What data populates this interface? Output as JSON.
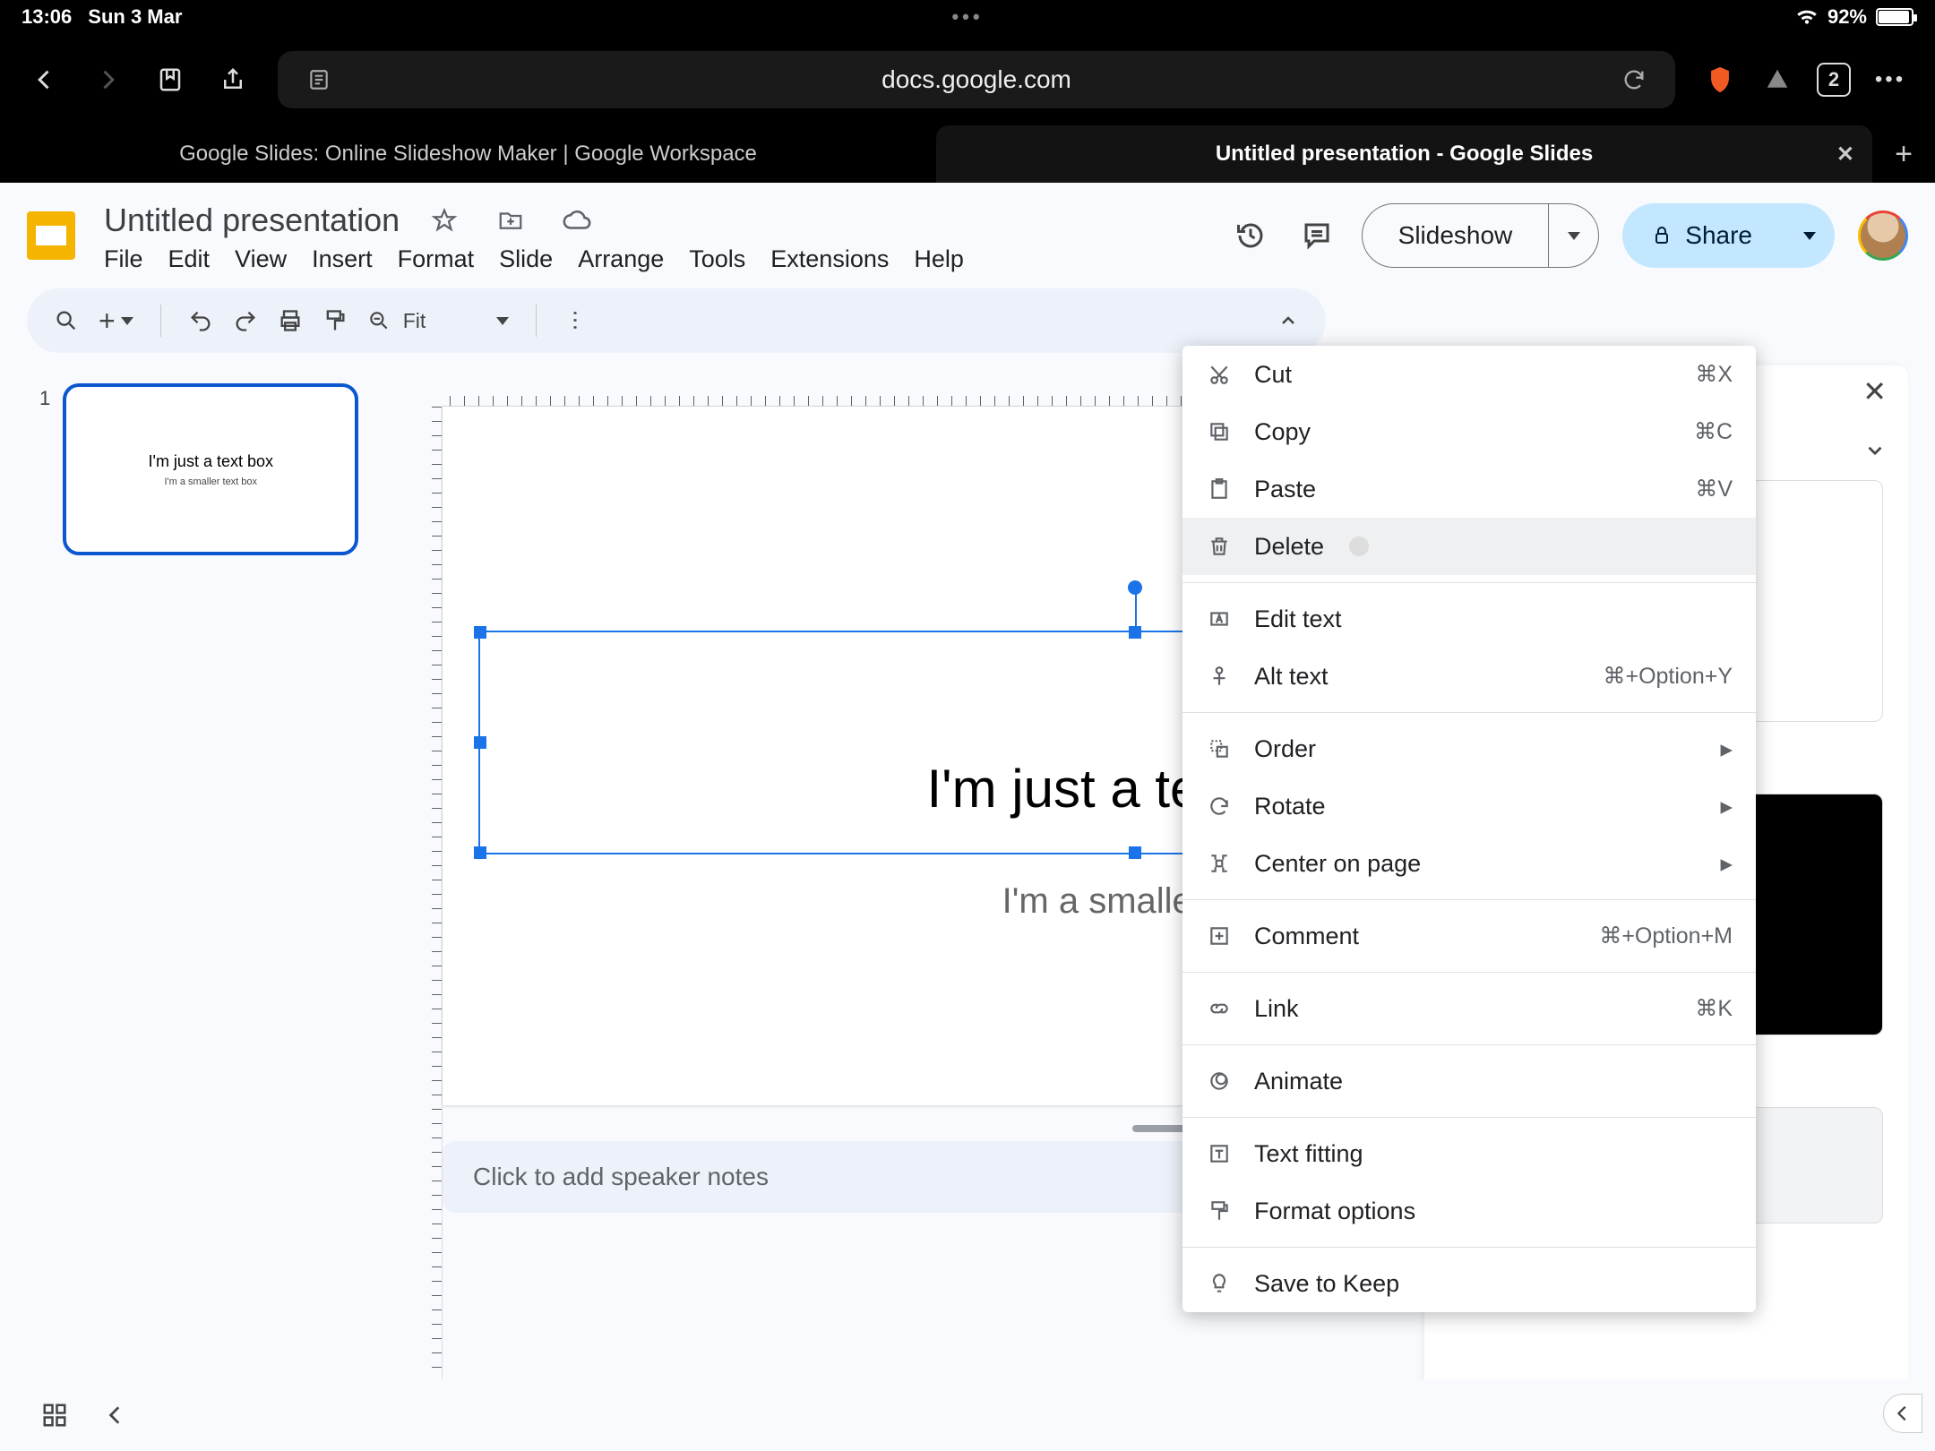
{
  "statusbar": {
    "time": "13:06",
    "date": "Sun 3 Mar",
    "battery": "92%"
  },
  "browser": {
    "url": "docs.google.com",
    "tab_count": "2",
    "tabs": {
      "inactive": "Google Slides: Online Slideshow Maker | Google Workspace",
      "active": "Untitled presentation - Google Slides"
    }
  },
  "doc": {
    "title": "Untitled presentation",
    "menus": [
      "File",
      "Edit",
      "View",
      "Insert",
      "Format",
      "Slide",
      "Arrange",
      "Tools",
      "Extensions",
      "Help"
    ]
  },
  "header_buttons": {
    "slideshow": "Slideshow",
    "share": "Share"
  },
  "toolbar": {
    "zoom": "Fit"
  },
  "thumb": {
    "num": "1",
    "title": "I'm just a text box",
    "subtitle": "I'm a smaller text box"
  },
  "canvas": {
    "title": "I'm just a text box",
    "subtitle": "I'm a smaller text box"
  },
  "notes_placeholder": "Click to add speaker notes",
  "ctx": {
    "cut": "Cut",
    "cut_k": "⌘X",
    "copy": "Copy",
    "copy_k": "⌘C",
    "paste": "Paste",
    "paste_k": "⌘V",
    "delete": "Delete",
    "edit_text": "Edit text",
    "alt_text": "Alt text",
    "alt_text_k": "⌘+Option+Y",
    "order": "Order",
    "rotate": "Rotate",
    "center": "Center on page",
    "comment": "Comment",
    "comment_k": "⌘+Option+M",
    "link": "Link",
    "link_k": "⌘K",
    "animate": "Animate",
    "text_fitting": "Text fitting",
    "format_options": "Format options",
    "save_keep": "Save to Keep"
  }
}
